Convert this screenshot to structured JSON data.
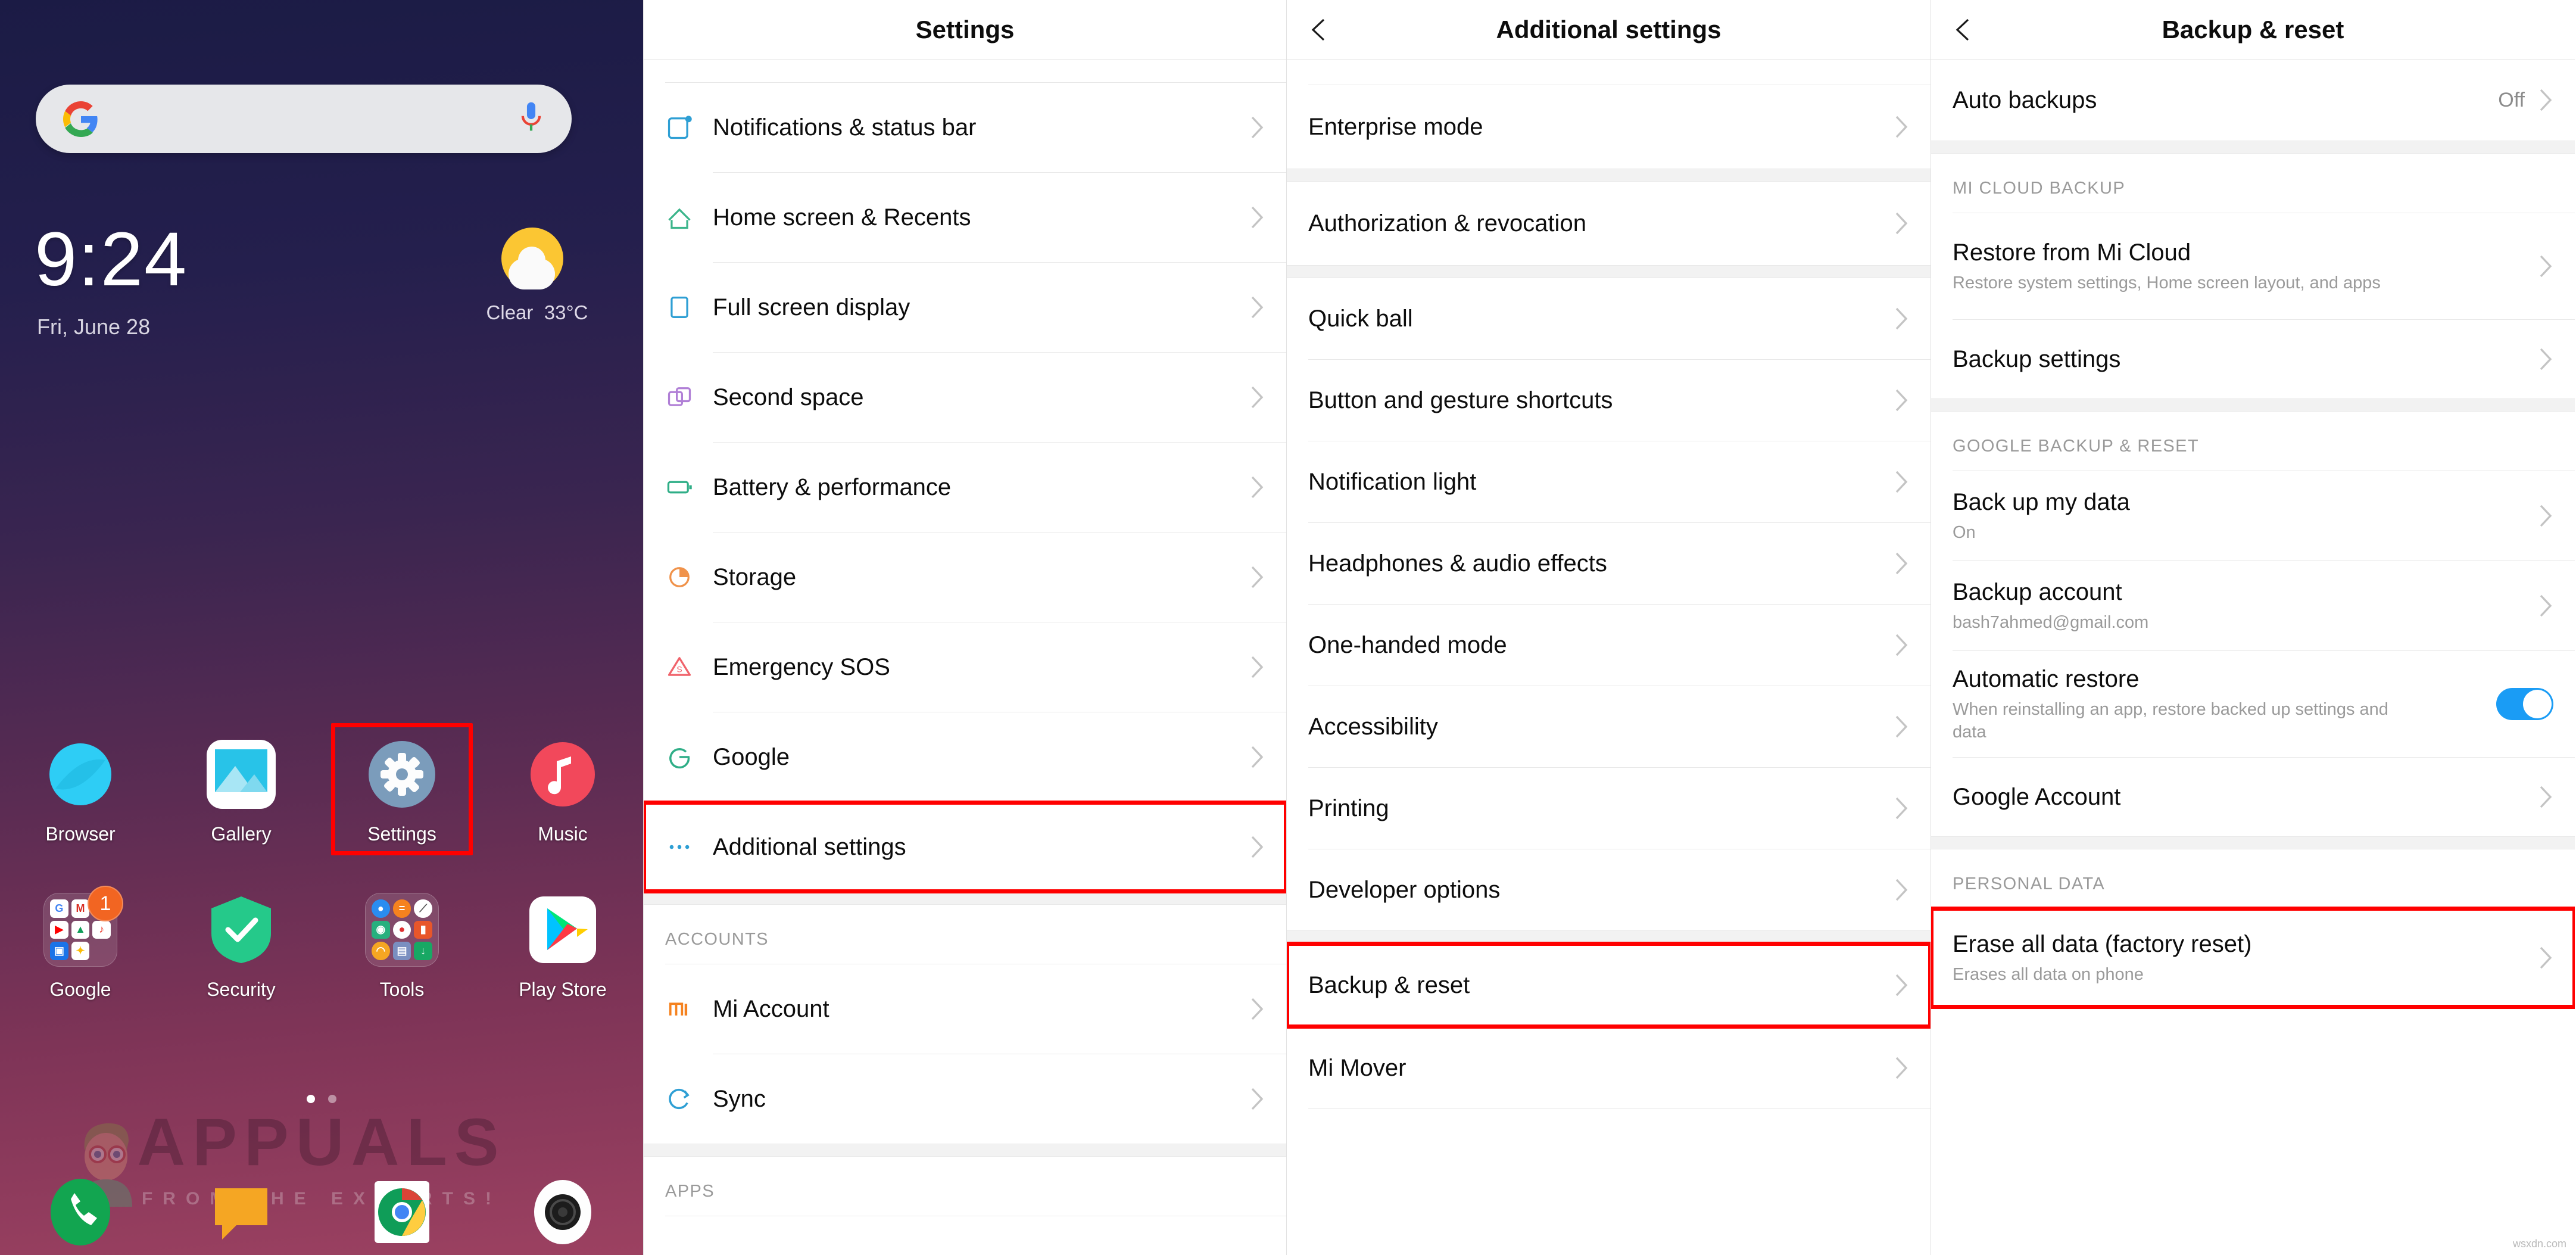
{
  "home": {
    "search": {
      "placeholder": "",
      "google_icon": "google-g-logo",
      "mic_icon": "microphone-icon"
    },
    "clock": "9:24",
    "date": "Fri, June 28",
    "weather": {
      "condition": "Clear",
      "temperature": "33°C",
      "icon": "sun-behind-cloud-icon"
    },
    "apps_row1": [
      {
        "label": "Browser",
        "icon": "browser-icon"
      },
      {
        "label": "Gallery",
        "icon": "gallery-icon"
      },
      {
        "label": "Settings",
        "icon": "settings-gear-icon",
        "highlighted": true
      },
      {
        "label": "Music",
        "icon": "music-icon"
      }
    ],
    "apps_row2": [
      {
        "label": "Google",
        "icon": "google-folder-icon",
        "badge": "1"
      },
      {
        "label": "Security",
        "icon": "security-shield-icon"
      },
      {
        "label": "Tools",
        "icon": "tools-folder-icon"
      },
      {
        "label": "Play Store",
        "icon": "play-store-icon"
      }
    ],
    "dock": [
      {
        "label": "Phone",
        "icon": "phone-icon"
      },
      {
        "label": "Messages",
        "icon": "messages-icon"
      },
      {
        "label": "Chrome",
        "icon": "chrome-icon"
      },
      {
        "label": "Camera",
        "icon": "camera-icon"
      }
    ],
    "page_indicator": {
      "total": 2,
      "active": 1
    },
    "watermark": {
      "main": "APPUALS",
      "sub": "FROM THE EXPERTS!"
    }
  },
  "settings": {
    "title": "Settings",
    "items": [
      {
        "label": "Notifications & status bar",
        "icon": "notification-bar-icon",
        "color": "#2e9fd4"
      },
      {
        "label": "Home screen & Recents",
        "icon": "home-icon",
        "color": "#3bb58b"
      },
      {
        "label": "Full screen display",
        "icon": "fullscreen-icon",
        "color": "#2e9fd4"
      },
      {
        "label": "Second space",
        "icon": "second-space-icon",
        "color": "#b07fd6"
      },
      {
        "label": "Battery & performance",
        "icon": "battery-icon",
        "color": "#2fae87"
      },
      {
        "label": "Storage",
        "icon": "storage-pie-icon",
        "color": "#f0924a"
      },
      {
        "label": "Emergency SOS",
        "icon": "emergency-sos-icon",
        "color": "#f0636b"
      },
      {
        "label": "Google",
        "icon": "google-g-outline-icon",
        "color": "#2fae87"
      },
      {
        "label": "Additional settings",
        "icon": "more-dots-icon",
        "color": "#2e9fd4",
        "highlighted": true
      }
    ],
    "group_accounts": "ACCOUNTS",
    "accounts": [
      {
        "label": "Mi Account",
        "icon": "mi-logo-icon",
        "color": "#f5821f"
      },
      {
        "label": "Sync",
        "icon": "sync-icon",
        "color": "#2e9fd4"
      }
    ],
    "group_apps": "APPS"
  },
  "additional": {
    "title": "Additional settings",
    "back_icon": "chevron-left-icon",
    "items": [
      {
        "label": "Enterprise mode"
      },
      {
        "label": "Authorization & revocation"
      },
      {
        "label": "Quick ball"
      },
      {
        "label": "Button and gesture shortcuts"
      },
      {
        "label": "Notification light"
      },
      {
        "label": "Headphones & audio effects"
      },
      {
        "label": "One-handed mode"
      },
      {
        "label": "Accessibility"
      },
      {
        "label": "Printing"
      },
      {
        "label": "Developer options"
      },
      {
        "label": "Backup & reset",
        "highlighted": true
      },
      {
        "label": "Mi Mover"
      }
    ]
  },
  "backup": {
    "title": "Backup & reset",
    "back_icon": "chevron-left-icon",
    "auto_backups": {
      "label": "Auto backups",
      "value": "Off"
    },
    "group_mi_cloud": "MI CLOUD BACKUP",
    "mi_cloud": [
      {
        "label": "Restore from Mi Cloud",
        "sub": "Restore system settings, Home screen layout, and apps"
      },
      {
        "label": "Backup settings"
      }
    ],
    "group_google": "GOOGLE BACKUP & RESET",
    "google": [
      {
        "label": "Back up my data",
        "sub": "On"
      },
      {
        "label": "Backup account",
        "sub": "bash7ahmed@gmail.com"
      },
      {
        "label": "Automatic restore",
        "sub": "When reinstalling an app, restore backed up settings and data",
        "toggle": true,
        "toggle_on": true
      },
      {
        "label": "Google Account"
      }
    ],
    "group_personal": "PERSONAL DATA",
    "personal": [
      {
        "label": "Erase all data (factory reset)",
        "sub": "Erases all data on phone",
        "highlighted": true
      }
    ],
    "credit": "wsxdn.com"
  },
  "accent": {
    "highlight": "#ff0000",
    "toggle_on": "#1a9cf5"
  }
}
